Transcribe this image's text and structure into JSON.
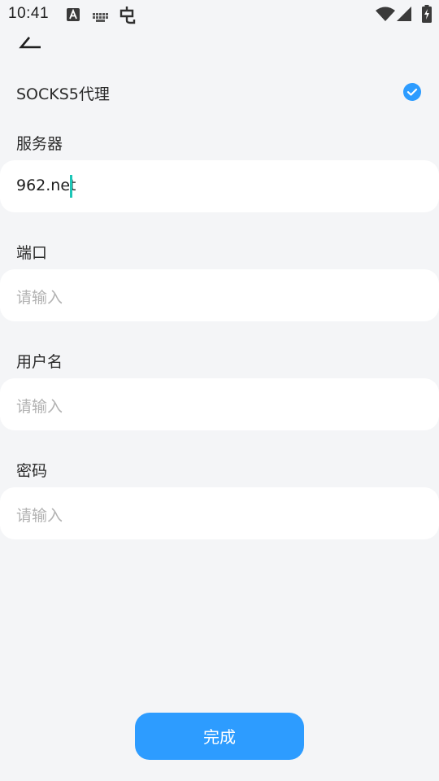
{
  "status_bar": {
    "time": "10:41",
    "icons": [
      "text-input-icon",
      "keyboard-icon",
      "bug-icon",
      "wifi-icon",
      "signal-icon",
      "battery-charging-icon"
    ]
  },
  "socks": {
    "label": "SOCKS5代理",
    "checked": true
  },
  "fields": {
    "server": {
      "label": "服务器",
      "value": "962.net"
    },
    "port": {
      "label": "端口",
      "placeholder": "请输入"
    },
    "username": {
      "label": "用户名",
      "placeholder": "请输入"
    },
    "password": {
      "label": "密码",
      "placeholder": "请输入"
    }
  },
  "done_button": {
    "label": "完成"
  },
  "colors": {
    "accent": "#2d9cff",
    "cursor": "#1cc6b7",
    "background": "#f4f5f7"
  }
}
